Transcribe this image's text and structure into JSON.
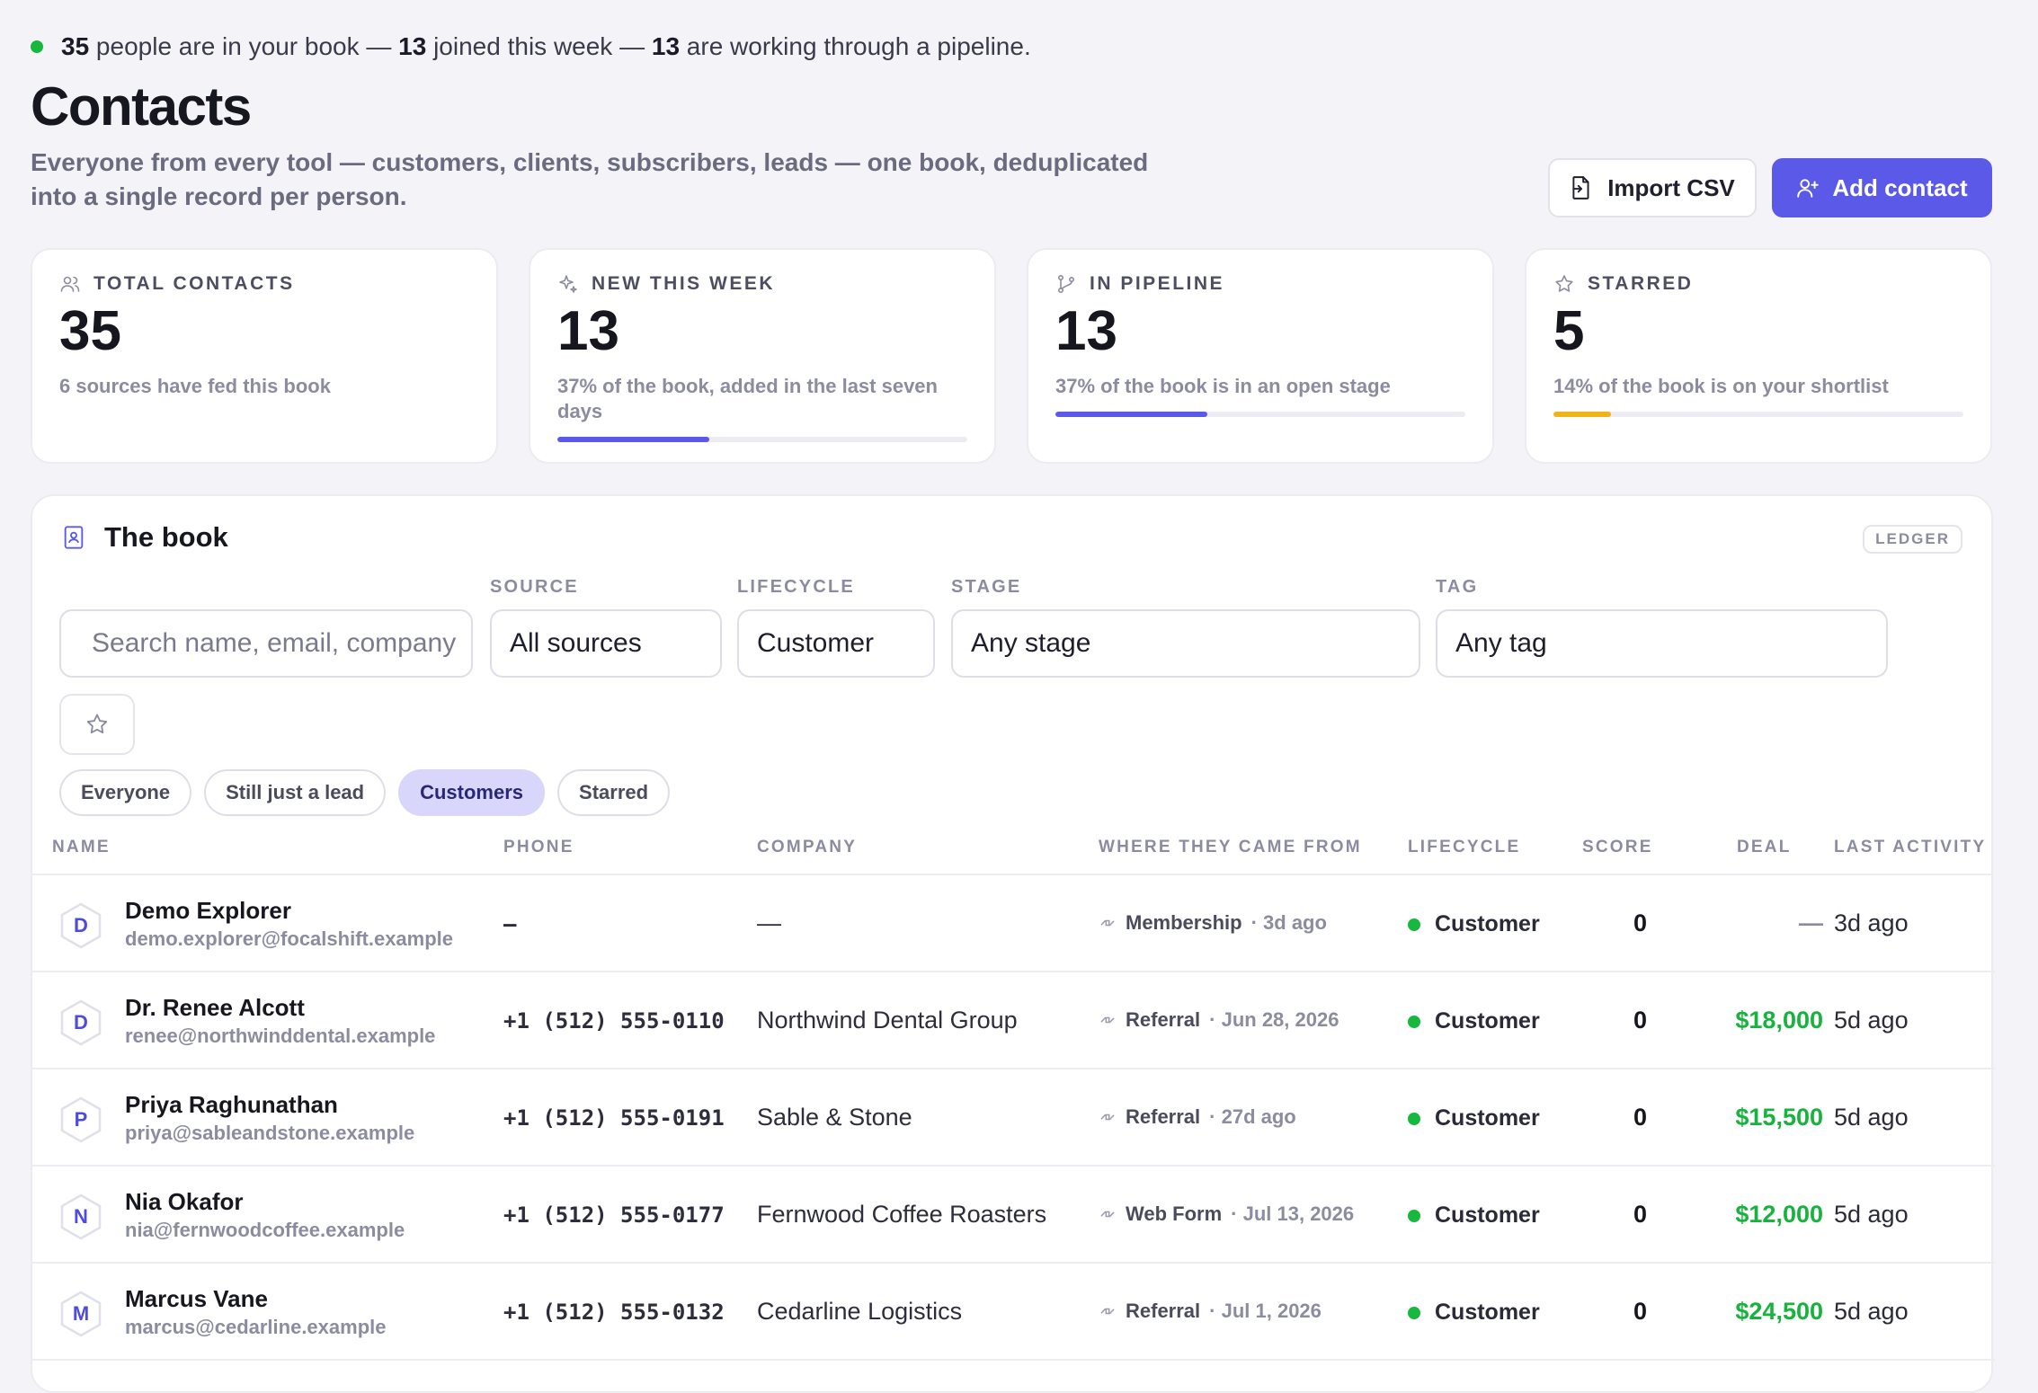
{
  "summary": {
    "total": "35",
    "part1": " people are in your book — ",
    "joined": "13",
    "part2": " joined this week — ",
    "pipeline": "13",
    "part3": " are working through a pipeline."
  },
  "page": {
    "title": "Contacts",
    "subtitle": "Everyone from every tool — customers, clients, subscribers, leads — one book, deduplicated into a single record per person."
  },
  "actions": {
    "import_label": "Import CSV",
    "add_label": "Add contact"
  },
  "stats": [
    {
      "icon": "users-icon",
      "label": "TOTAL CONTACTS",
      "value": "35",
      "note": "6 sources have fed this book",
      "progress": null,
      "color": ""
    },
    {
      "icon": "sparkle-icon",
      "label": "NEW THIS WEEK",
      "value": "13",
      "note": "37% of the book, added in the last seven days",
      "progress": 0.37,
      "color": "#5b5ae8"
    },
    {
      "icon": "git-branch-icon",
      "label": "IN PIPELINE",
      "value": "13",
      "note": "37% of the book is in an open stage",
      "progress": 0.37,
      "color": "#5b5ae8"
    },
    {
      "icon": "star-icon",
      "label": "STARRED",
      "value": "5",
      "note": "14% of the book is on your shortlist",
      "progress": 0.14,
      "color": "#f0b31a"
    }
  ],
  "book": {
    "title": "The book",
    "badge": "LEDGER",
    "search_placeholder": "Search name, email, company",
    "filters": {
      "source_label": "SOURCE",
      "source_value": "All sources",
      "lifecycle_label": "LIFECYCLE",
      "lifecycle_value": "Customer",
      "stage_label": "STAGE",
      "stage_value": "Any stage",
      "tag_label": "TAG",
      "tag_value": "Any tag"
    },
    "chips": [
      {
        "label": "Everyone",
        "active": false
      },
      {
        "label": "Still just a lead",
        "active": false
      },
      {
        "label": "Customers",
        "active": true
      },
      {
        "label": "Starred",
        "active": false
      }
    ],
    "columns": {
      "name": "NAME",
      "phone": "PHONE",
      "company": "COMPANY",
      "source": "WHERE THEY CAME FROM",
      "lifecycle": "LIFECYCLE",
      "score": "SCORE",
      "deal": "DEAL",
      "last_activity": "LAST ACTIVITY"
    },
    "rows": [
      {
        "initial": "D",
        "name": "Demo Explorer",
        "email": "demo.explorer@focalshift.example",
        "phone": "–",
        "company": "—",
        "source": "Membership",
        "source_time": "· 3d ago",
        "lifecycle": "Customer",
        "score": "0",
        "deal": "—",
        "last": "3d ago"
      },
      {
        "initial": "D",
        "name": "Dr. Renee Alcott",
        "email": "renee@northwinddental.example",
        "phone": "+1 (512) 555-0110",
        "company": "Northwind Dental Group",
        "source": "Referral",
        "source_time": "· Jun 28, 2026",
        "lifecycle": "Customer",
        "score": "0",
        "deal": "$18,000",
        "last": "5d ago"
      },
      {
        "initial": "P",
        "name": "Priya Raghunathan",
        "email": "priya@sableandstone.example",
        "phone": "+1 (512) 555-0191",
        "company": "Sable & Stone",
        "source": "Referral",
        "source_time": "· 27d ago",
        "lifecycle": "Customer",
        "score": "0",
        "deal": "$15,500",
        "last": "5d ago"
      },
      {
        "initial": "N",
        "name": "Nia Okafor",
        "email": "nia@fernwoodcoffee.example",
        "phone": "+1 (512) 555-0177",
        "company": "Fernwood Coffee Roasters",
        "source": "Web Form",
        "source_time": "· Jul 13, 2026",
        "lifecycle": "Customer",
        "score": "0",
        "deal": "$12,000",
        "last": "5d ago"
      },
      {
        "initial": "M",
        "name": "Marcus Vane",
        "email": "marcus@cedarline.example",
        "phone": "+1 (512) 555-0132",
        "company": "Cedarline Logistics",
        "source": "Referral",
        "source_time": "· Jul 1, 2026",
        "lifecycle": "Customer",
        "score": "0",
        "deal": "$24,500",
        "last": "5d ago"
      }
    ]
  }
}
